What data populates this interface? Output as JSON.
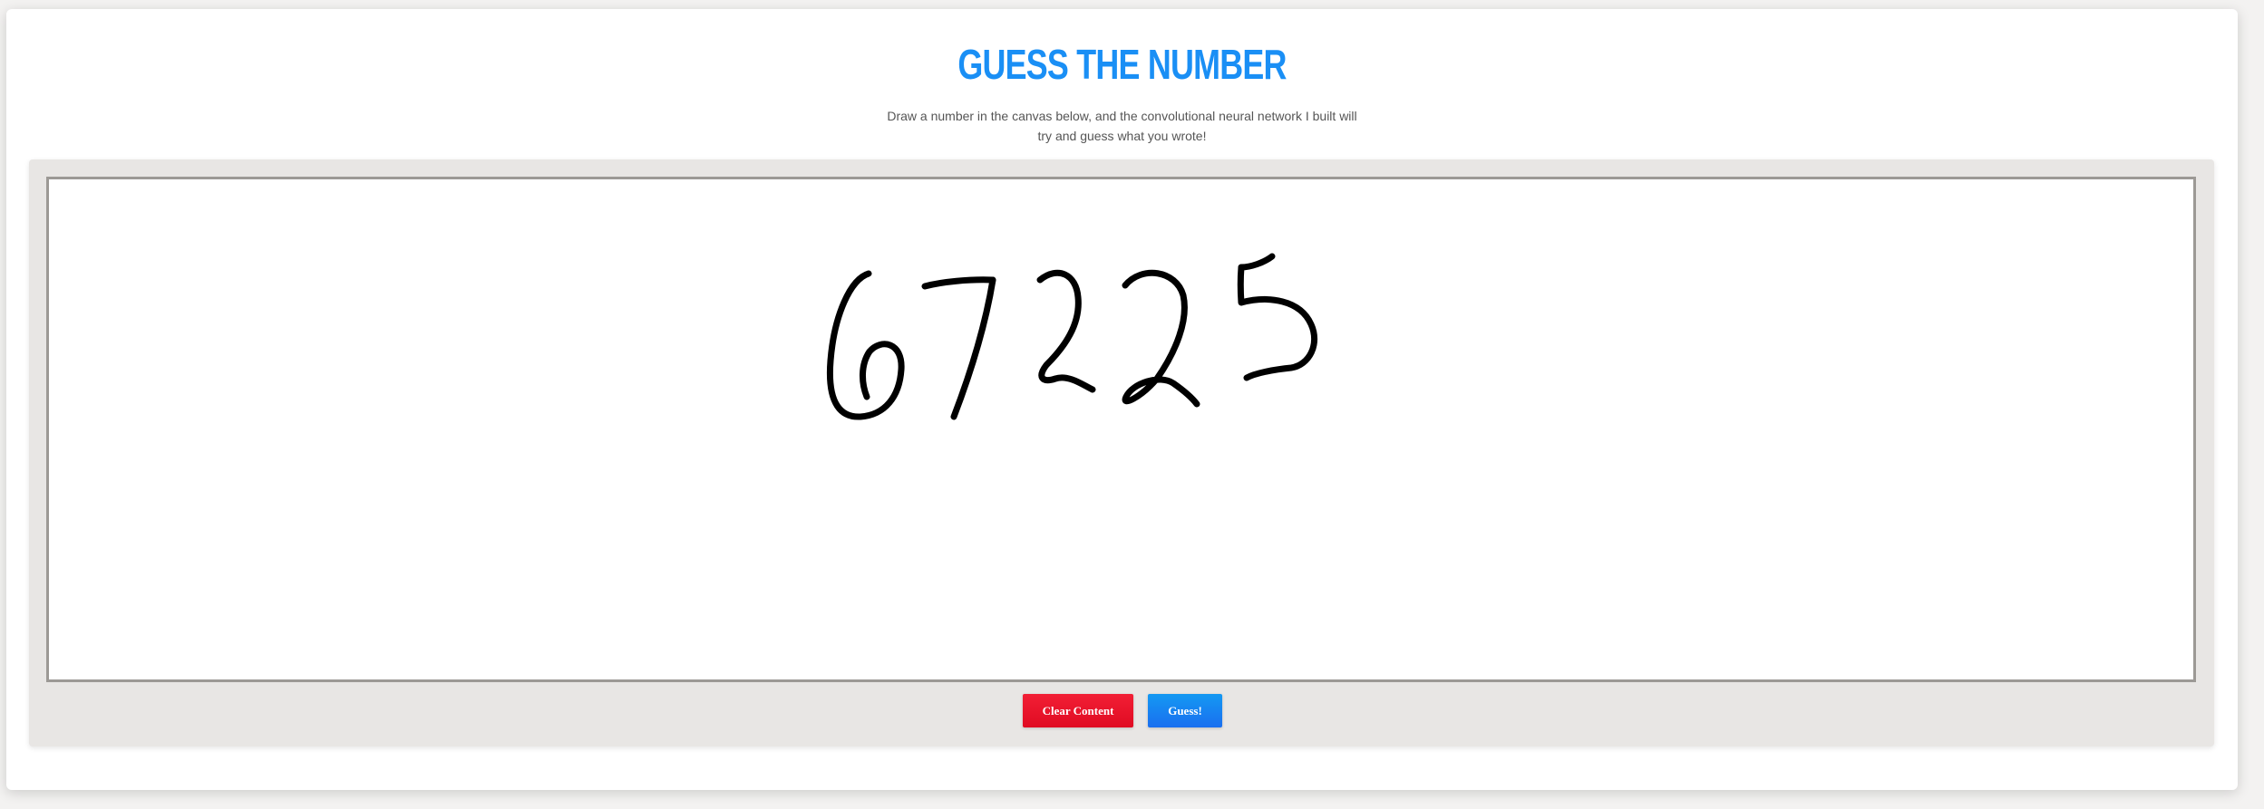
{
  "header": {
    "title": "GUESS THE NUMBER",
    "description_line1": "Draw a number in the canvas below, and the convolutional neural network I built will",
    "description_line2": "try and guess what you wrote!"
  },
  "canvas": {
    "stroke_color": "#000000",
    "background": "#ffffff"
  },
  "actions": {
    "clear_label": "Clear Content",
    "guess_label": "Guess!"
  },
  "colors": {
    "title": "#1a8ff5",
    "clear_button": "#ec1530",
    "guess_button": "#1a84f2",
    "panel": "#e8e6e4"
  }
}
